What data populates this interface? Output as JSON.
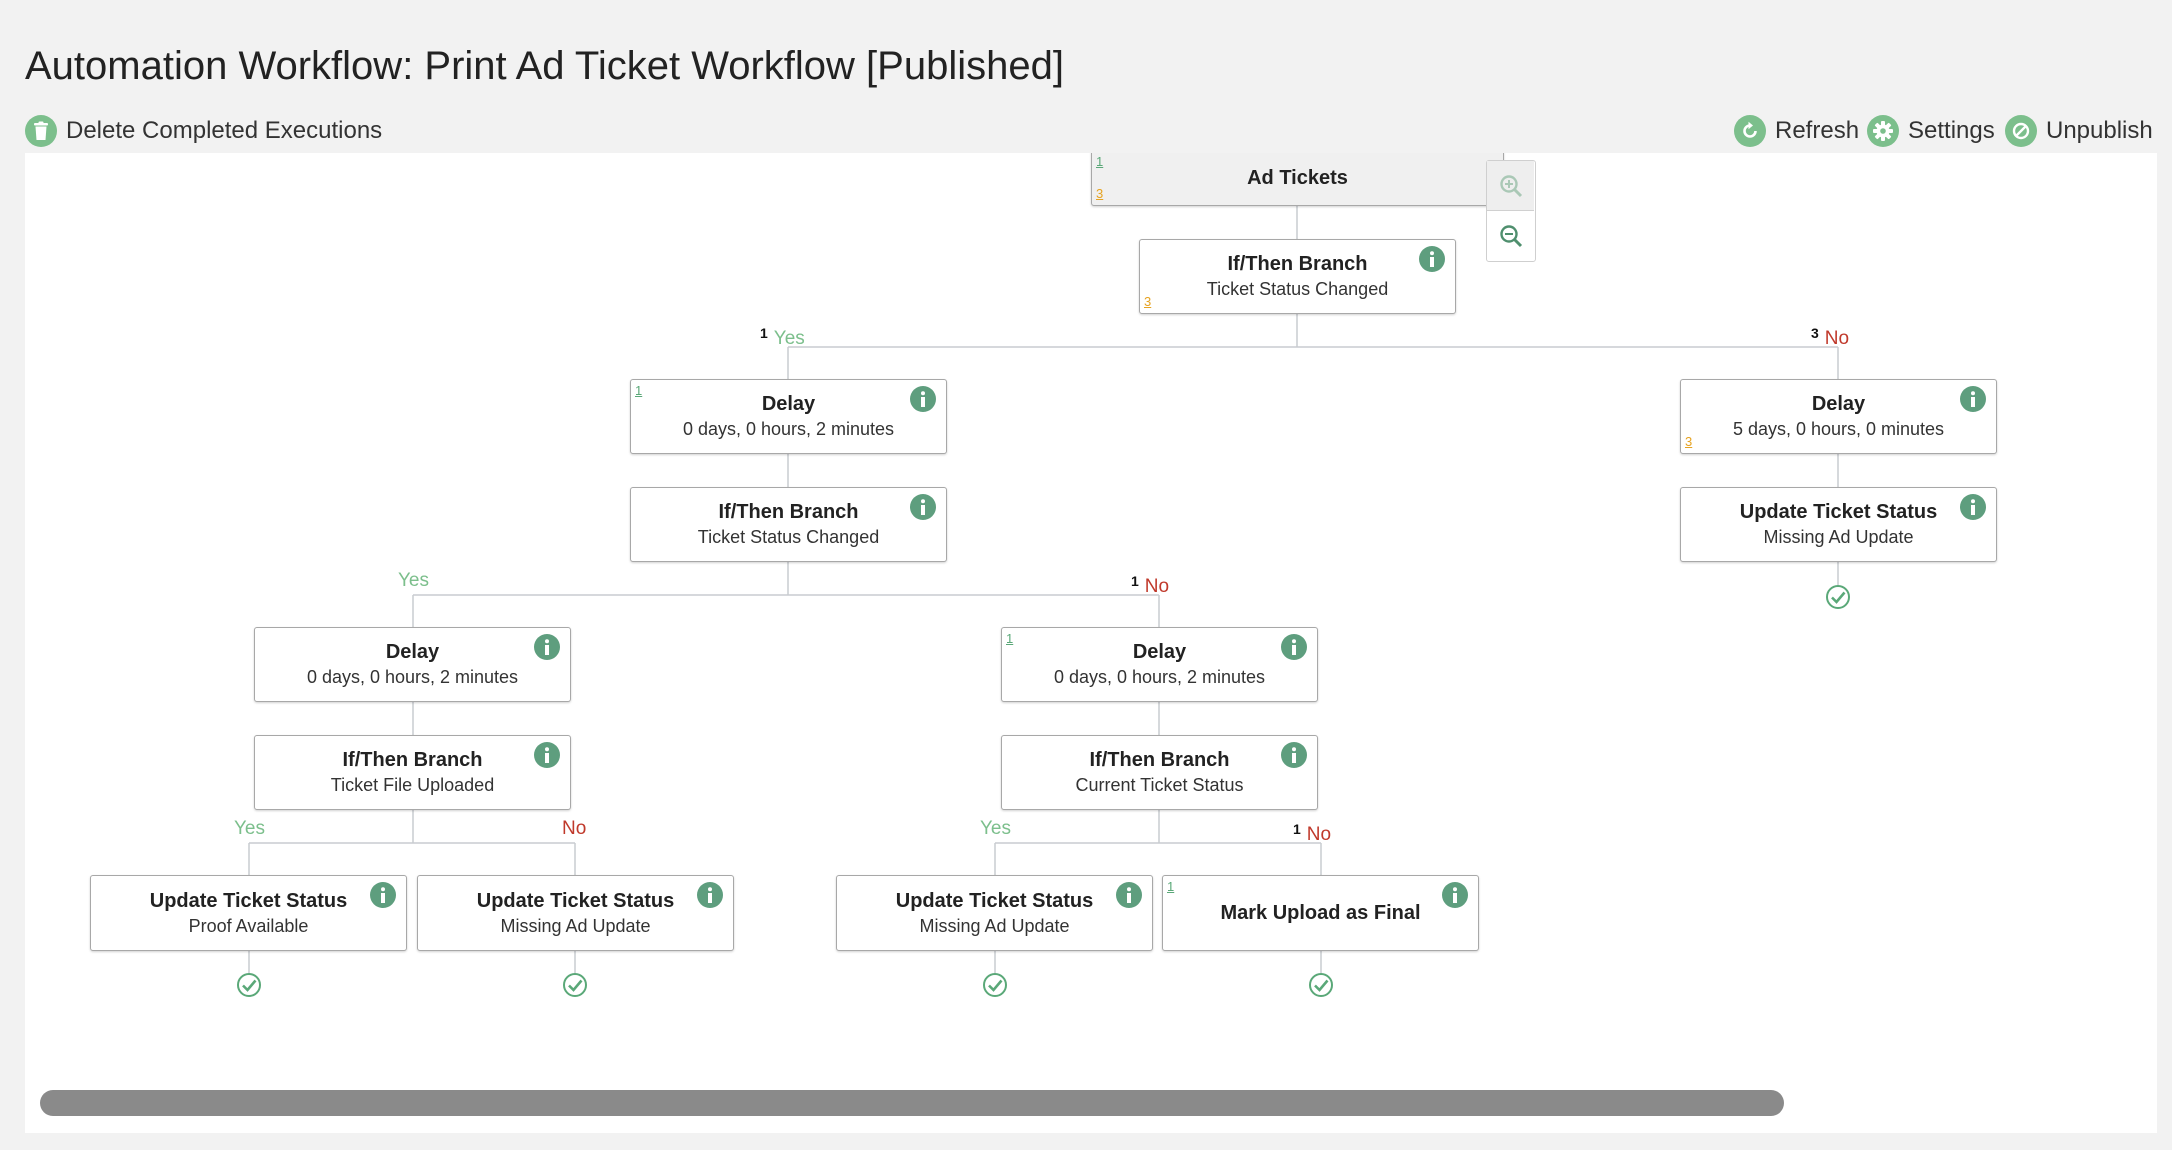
{
  "header": {
    "title": "Automation Workflow: Print Ad Ticket Workflow [Published]"
  },
  "toolbar": {
    "delete_label": "Delete Completed Executions",
    "refresh_label": "Refresh",
    "settings_label": "Settings",
    "unpublish_label": "Unpublish"
  },
  "colors": {
    "accent": "#7cbf8c",
    "info": "#5e9e7e",
    "yes": "#7cbf8c",
    "no": "#c0392b",
    "count_success": "#5aa878",
    "count_pending": "#e6a322"
  },
  "workflow": {
    "root": {
      "title": "Ad Tickets",
      "count_top": "1",
      "count_bottom": "3"
    },
    "branch1": {
      "title": "If/Then Branch",
      "subtitle": "Ticket Status Changed",
      "count_bottom": "3"
    },
    "yes_label": {
      "count": "1",
      "label": "Yes"
    },
    "no_label": {
      "count": "3",
      "label": "No"
    },
    "delay_yes": {
      "title": "Delay",
      "subtitle": "0 days, 0 hours, 2 minutes",
      "count_top": "1"
    },
    "delay_no": {
      "title": "Delay",
      "subtitle": "5 days, 0 hours, 0 minutes",
      "count_bottom": "3"
    },
    "update_no": {
      "title": "Update Ticket Status",
      "subtitle": "Missing Ad Update"
    },
    "branch2": {
      "title": "If/Then Branch",
      "subtitle": "Ticket Status Changed"
    },
    "b2_yes": {
      "label": "Yes"
    },
    "b2_no": {
      "count": "1",
      "label": "No"
    },
    "delay_b2yes": {
      "title": "Delay",
      "subtitle": "0 days, 0 hours, 2 minutes"
    },
    "delay_b2no": {
      "title": "Delay",
      "subtitle": "0 days, 0 hours, 2 minutes",
      "count_top": "1"
    },
    "branch3": {
      "title": "If/Then Branch",
      "subtitle": "Ticket File Uploaded"
    },
    "branch4": {
      "title": "If/Then Branch",
      "subtitle": "Current Ticket Status"
    },
    "b3_yes": {
      "label": "Yes"
    },
    "b3_no": {
      "label": "No"
    },
    "b4_yes": {
      "label": "Yes"
    },
    "b4_no": {
      "count": "1",
      "label": "No"
    },
    "leaf1": {
      "title": "Update Ticket Status",
      "subtitle": "Proof Available"
    },
    "leaf2": {
      "title": "Update Ticket Status",
      "subtitle": "Missing Ad Update"
    },
    "leaf3": {
      "title": "Update Ticket Status",
      "subtitle": "Missing Ad Update"
    },
    "leaf4": {
      "title": "Mark Upload as Final",
      "count_top": "1"
    }
  }
}
